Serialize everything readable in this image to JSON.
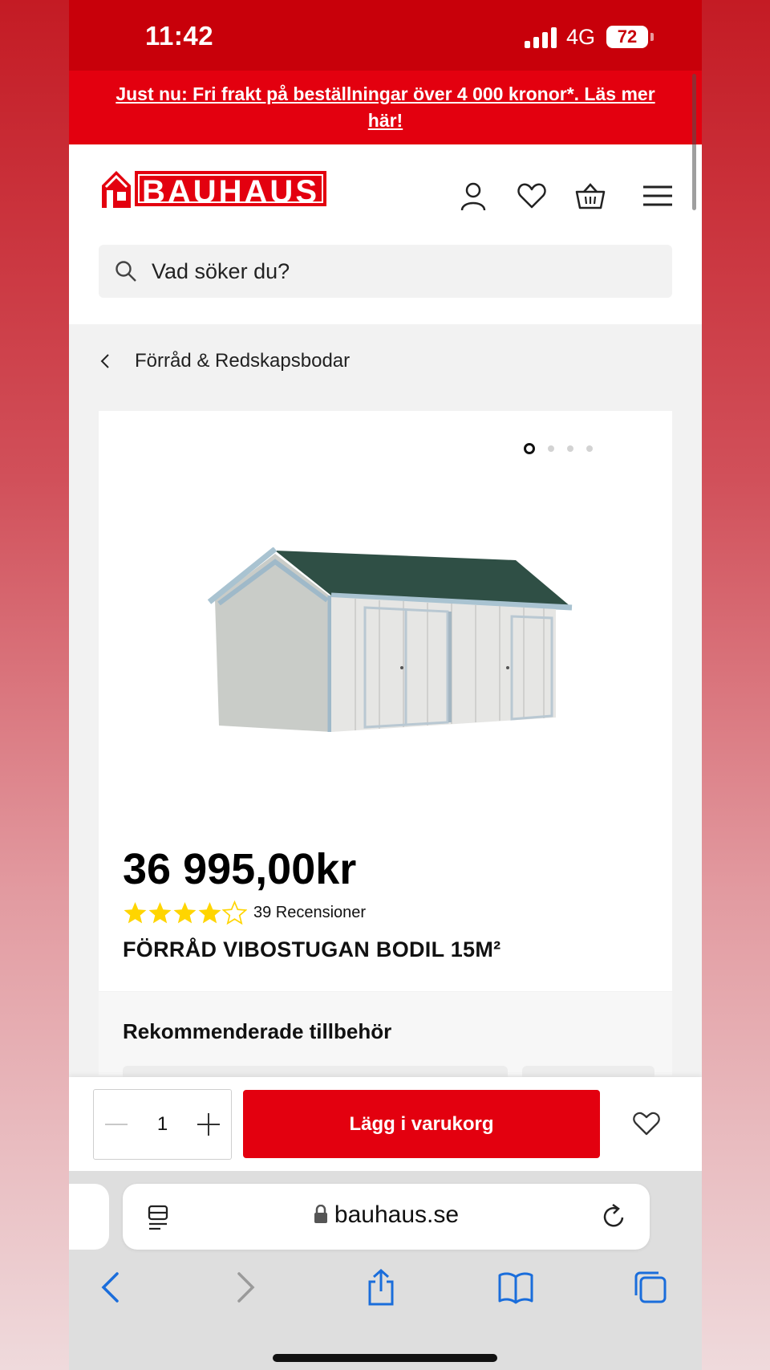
{
  "status_bar": {
    "time": "11:42",
    "network": "4G",
    "battery": "72"
  },
  "promo": {
    "text": "Just nu: Fri frakt på beställningar över 4 000 kronor*. Läs mer här!"
  },
  "header": {
    "logo_text": "BAUHAUS",
    "icons": [
      "account-icon",
      "heart-icon",
      "basket-icon",
      "menu-icon"
    ]
  },
  "search": {
    "placeholder": "Vad söker du?"
  },
  "breadcrumb": {
    "label": "Förråd & Redskapsbodar"
  },
  "product": {
    "image_count": 4,
    "active_image": 1,
    "price": "36 995,00kr",
    "rating": 4,
    "rating_max": 5,
    "reviews": "39 Recensioner",
    "title": "FÖRRÅD VIBOSTUGAN BODIL 15M²"
  },
  "recommended": {
    "title": "Rekommenderade tillbehör"
  },
  "cart_bar": {
    "quantity": "1",
    "add_label": "Lägg i varukorg"
  },
  "safari": {
    "url": "bauhaus.se"
  },
  "colors": {
    "brand_red": "#e3000f",
    "status_red": "#c8000a",
    "star_yellow": "#ffd500"
  }
}
